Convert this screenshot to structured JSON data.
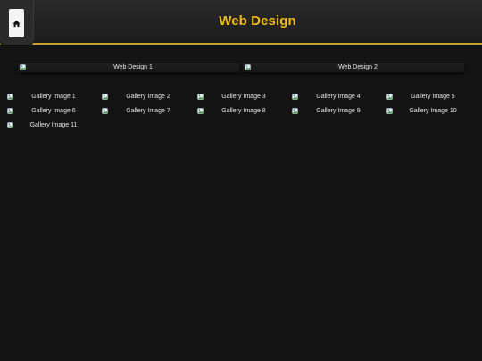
{
  "header": {
    "title": "Web Design",
    "home_icon": "home-icon",
    "accent_color": "#f0bc1c",
    "border_color": "#c9a227"
  },
  "featured": [
    {
      "label": "Web Design 1",
      "icon": "broken-image-icon"
    },
    {
      "label": "Web Design 2",
      "icon": "broken-image-icon"
    }
  ],
  "gallery": [
    {
      "label": "Gallery Image 1",
      "icon": "broken-image-icon"
    },
    {
      "label": "Gallery Image 2",
      "icon": "broken-image-icon"
    },
    {
      "label": "Gallery Image 3",
      "icon": "broken-image-icon"
    },
    {
      "label": "Gallery Image 4",
      "icon": "broken-image-icon"
    },
    {
      "label": "Gallery Image 5",
      "icon": "broken-image-icon"
    },
    {
      "label": "Gallery Image 6",
      "icon": "broken-image-icon"
    },
    {
      "label": "Gallery Image 7",
      "icon": "broken-image-icon"
    },
    {
      "label": "Gallery Image 8",
      "icon": "broken-image-icon"
    },
    {
      "label": "Gallery Image 9",
      "icon": "broken-image-icon"
    },
    {
      "label": "Gallery Image 10",
      "icon": "broken-image-icon"
    },
    {
      "label": "Gallery Image 11",
      "icon": "broken-image-icon"
    }
  ]
}
